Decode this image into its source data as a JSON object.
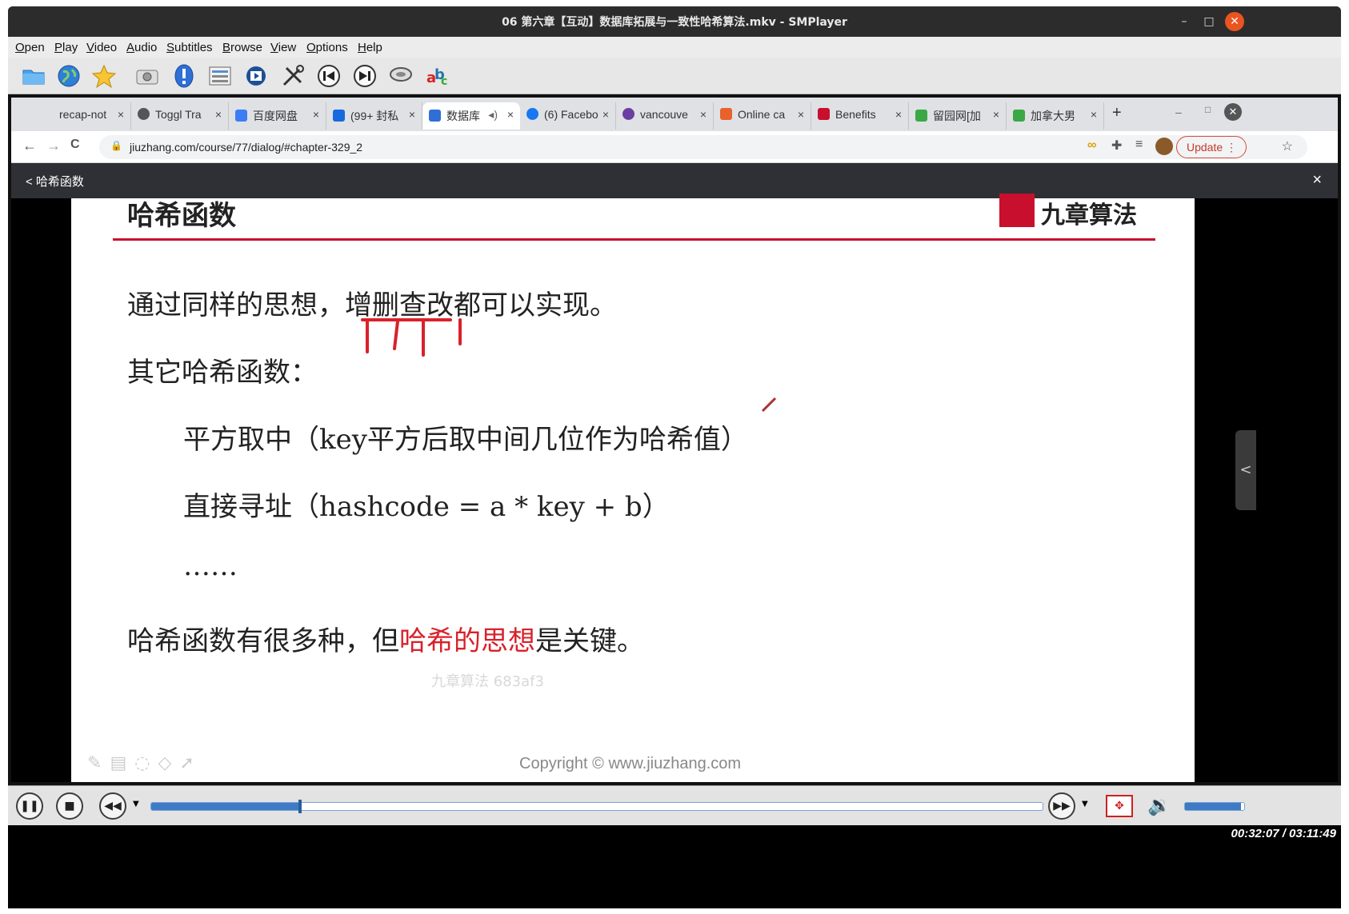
{
  "window": {
    "title": "06 第六章【互动】数据库拓展与一致性哈希算法.mkv - SMPlayer",
    "controls": {
      "minimize": "–",
      "maximize": "□",
      "close": "✕"
    }
  },
  "menu": {
    "items": [
      "Open",
      "Play",
      "Video",
      "Audio",
      "Subtitles",
      "Browse",
      "View",
      "Options",
      "Help"
    ]
  },
  "toolbar": {
    "icons": [
      "open-folder-icon",
      "web-globe-icon",
      "favorites-star-icon",
      "screenshot-camera-icon",
      "info-icon",
      "playlist-icon",
      "media-icon",
      "preferences-tools-icon",
      "previous-icon",
      "next-icon",
      "audio-icon",
      "subtitles-icon"
    ]
  },
  "browser": {
    "tabs": [
      {
        "label": "recap-not",
        "color": "#888888"
      },
      {
        "label": "Toggl Tra",
        "color": "#555555"
      },
      {
        "label": "百度网盘",
        "color": "#3c7df5"
      },
      {
        "label": "(99+ 封私",
        "color": "#1769e0"
      },
      {
        "label": "数据库",
        "color": "#2f6fd6"
      },
      {
        "label": "(6) Facebo",
        "color": "#1877f2"
      },
      {
        "label": "vancouve",
        "color": "#6b3ea1"
      },
      {
        "label": "Online ca",
        "color": "#e8622c"
      },
      {
        "label": "Benefits",
        "color": "#c8102e"
      },
      {
        "label": "留园网[加",
        "color": "#3aa845"
      },
      {
        "label": "加拿大男",
        "color": "#3aa845"
      }
    ],
    "new_tab": "+",
    "address": {
      "back": "←",
      "forward": "→",
      "reload": "C",
      "url": "jiuzhang.com/course/77/dialog/#chapter-329_2",
      "update_label": "Update ⋮"
    },
    "page_bar": {
      "back_label": "<  哈希函数",
      "close": "×"
    }
  },
  "slide": {
    "heading": "哈希函数",
    "logo_text": "九章算法",
    "line1": "通过同样的思想，增删查改都可以实现。",
    "line2": "其它哈希函数：",
    "line3": "平方取中（key平方后取中间几位作为哈希值）",
    "line4": "直接寻址（hashcode = a * key + b）",
    "line5": "……",
    "line6_a": "哈希函数有很多种，但",
    "line6_b": "哈希的思想",
    "line6_c": "是关键。",
    "watermark": "九章算法 683af3",
    "copyright": "Copyright © www.jiuzhang.com",
    "side_handle": "<"
  },
  "player": {
    "position": "00:32:07",
    "duration": "03:11:49",
    "time_display": "00:32:07 / 03:11:49",
    "seek_fraction": 0.1673,
    "volume_fraction": 0.95,
    "accent_color": "#3d7bc6"
  }
}
